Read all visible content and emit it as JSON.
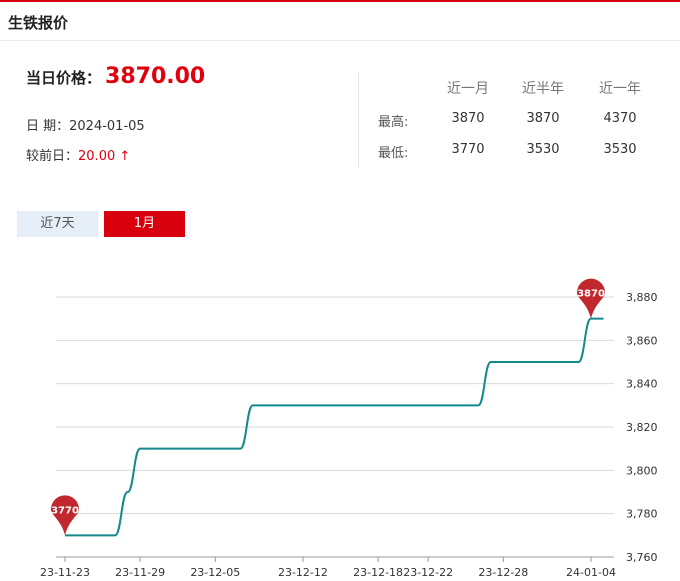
{
  "header": {
    "title": "生铁报价"
  },
  "price": {
    "label": "当日价格：",
    "value": "3870.00",
    "date_label": "日 期：",
    "date": "2024-01-05",
    "change_label": "较前日：",
    "change": "20.00 ↑"
  },
  "stats": {
    "columns": [
      "近一月",
      "近半年",
      "近一年"
    ],
    "rows": [
      {
        "label": "最高:",
        "values": [
          "3870",
          "3870",
          "4370"
        ]
      },
      {
        "label": "最低:",
        "values": [
          "3770",
          "3530",
          "3530"
        ]
      }
    ]
  },
  "tabs": [
    {
      "label": "近7天",
      "active": false
    },
    {
      "label": "1月",
      "active": true
    }
  ],
  "colors": {
    "accent": "#d9000d",
    "line": "#128a8a",
    "pin": "#c0282d"
  },
  "chart_data": {
    "type": "line",
    "x_ticks": [
      "23-11-23",
      "23-11-29",
      "23-12-05",
      "23-12-12",
      "23-12-18",
      "23-12-22",
      "23-12-28",
      "24-01-04"
    ],
    "x": [
      "23-11-23",
      "23-11-24",
      "23-11-27",
      "23-11-28",
      "23-11-29",
      "23-11-30",
      "23-12-01",
      "23-12-04",
      "23-12-05",
      "23-12-06",
      "23-12-07",
      "23-12-08",
      "23-12-11",
      "23-12-12",
      "23-12-13",
      "23-12-14",
      "23-12-15",
      "23-12-18",
      "23-12-19",
      "23-12-20",
      "23-12-21",
      "23-12-22",
      "23-12-25",
      "23-12-26",
      "23-12-27",
      "23-12-28",
      "23-12-29",
      "24-01-02",
      "24-01-03",
      "24-01-04",
      "24-01-05"
    ],
    "values": [
      3770,
      3770,
      3770,
      3790,
      3810,
      3810,
      3810,
      3810,
      3810,
      3810,
      3810,
      3830,
      3830,
      3830,
      3830,
      3830,
      3830,
      3830,
      3830,
      3830,
      3830,
      3830,
      3830,
      3830,
      3850,
      3850,
      3850,
      3850,
      3850,
      3870,
      3870
    ],
    "ylim": [
      3760,
      3880
    ],
    "y_ticks": [
      "3,760",
      "3,780",
      "3,800",
      "3,820",
      "3,840",
      "3,860",
      "3,880"
    ],
    "grid": true,
    "markers": [
      {
        "label": "3770",
        "index": 0
      },
      {
        "label": "3870",
        "index": 29
      }
    ]
  }
}
